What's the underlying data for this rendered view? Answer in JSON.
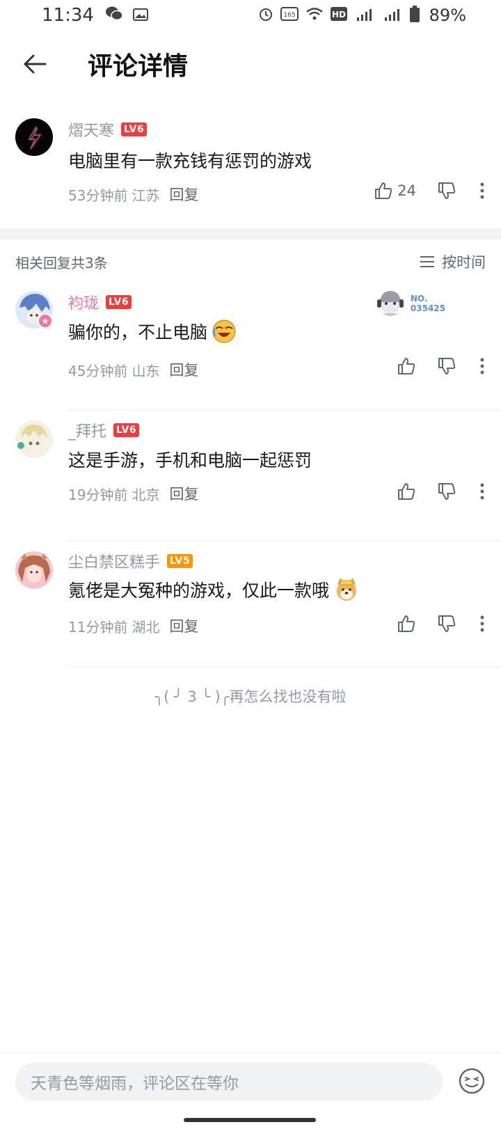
{
  "status_bar": {
    "time": "11:34",
    "battery": "89%",
    "icons": [
      "wechat-icon",
      "gallery-icon",
      "alarm-icon",
      "refresh-rate-icon",
      "wifi-icon",
      "hd-icon",
      "signal-5g-icon",
      "signal-5g-icon",
      "battery-icon"
    ]
  },
  "header": {
    "title": "评论详情"
  },
  "main_comment": {
    "username": "熠天寒",
    "level": "LV6",
    "text": "电脑里有一款充钱有惩罚的游戏",
    "time": "53分钟前",
    "location": "江苏",
    "reply_label": "回复",
    "likes": "24"
  },
  "replies_header": {
    "count_label": "相关回复共3条",
    "sort_label": "按时间"
  },
  "badge": {
    "line1": "NO.",
    "line2": "035425"
  },
  "replies": [
    {
      "username": "袀珑",
      "level": "LV6",
      "text": "骗你的，不止电脑",
      "time": "45分钟前",
      "location": "山东",
      "reply_label": "回复"
    },
    {
      "username": "_拜托",
      "level": "LV6",
      "text": "这是手游，手机和电脑一起惩罚",
      "time": "19分钟前",
      "location": "北京",
      "reply_label": "回复"
    },
    {
      "username": "尘白禁区糕手",
      "level": "LV5",
      "text": "氪佬是大冤种的游戏，仅此一款哦",
      "time": "11分钟前",
      "location": "湖北",
      "reply_label": "回复"
    }
  ],
  "end_tip": "╮( ╯ 3 ╰ )╭再怎么找也没有啦",
  "input": {
    "placeholder": "天青色等烟雨，评论区在等你"
  },
  "colors": {
    "accent_pink": "#fb7299",
    "level_red": "#f23c3c",
    "level_orange": "#ff9500",
    "meta_gray": "#9499a0"
  }
}
